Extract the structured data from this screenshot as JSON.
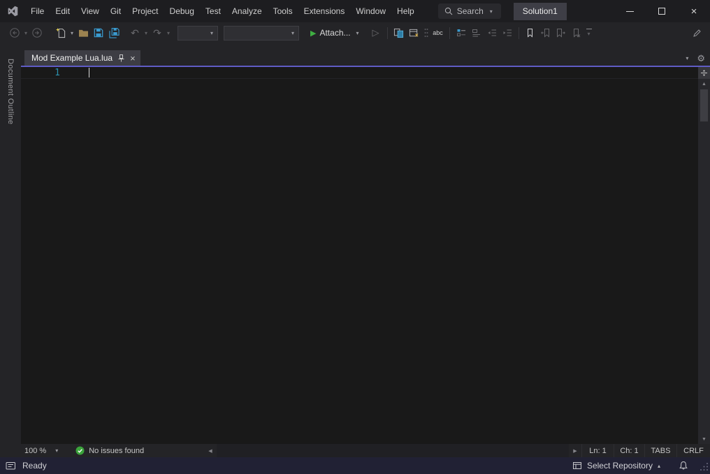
{
  "title_bar": {
    "menus": [
      "File",
      "Edit",
      "View",
      "Git",
      "Project",
      "Debug",
      "Test",
      "Analyze",
      "Tools",
      "Extensions",
      "Window",
      "Help"
    ],
    "search_label": "Search",
    "solution_name": "Solution1"
  },
  "toolbar": {
    "attach_label": "Attach...",
    "spell_check_label": "abc",
    "configuration_value": "",
    "platform_value": ""
  },
  "side_panel": {
    "title": "Document Outline"
  },
  "tab_bar": {
    "active_tab": "Mod Example Lua.lua"
  },
  "editor": {
    "line_number": "1",
    "content": ""
  },
  "editor_status_bar": {
    "zoom": "100 %",
    "health": "No issues found",
    "line": "Ln: 1",
    "column": "Ch: 1",
    "indent_mode": "TABS",
    "line_ending": "CRLF"
  },
  "status_bar": {
    "message": "Ready",
    "repository_label": "Select Repository"
  },
  "icons": {
    "caret_down": "▾",
    "caret_up": "▴",
    "undo": "↶",
    "redo": "↷",
    "play": "▶",
    "play_outline": "▷",
    "close": "×",
    "gear": "⚙",
    "arrow_up": "▲",
    "arrow_down": "▼",
    "arrow_left": "◀",
    "arrow_right": "▶"
  },
  "colors": {
    "accent_purple": "#5f5cc5",
    "save_blue": "#3a9bd0",
    "run_green": "#3fae42",
    "health_green": "#3ba33b",
    "line_number_teal": "#2b91af",
    "status_bar_bg": "#212134"
  }
}
